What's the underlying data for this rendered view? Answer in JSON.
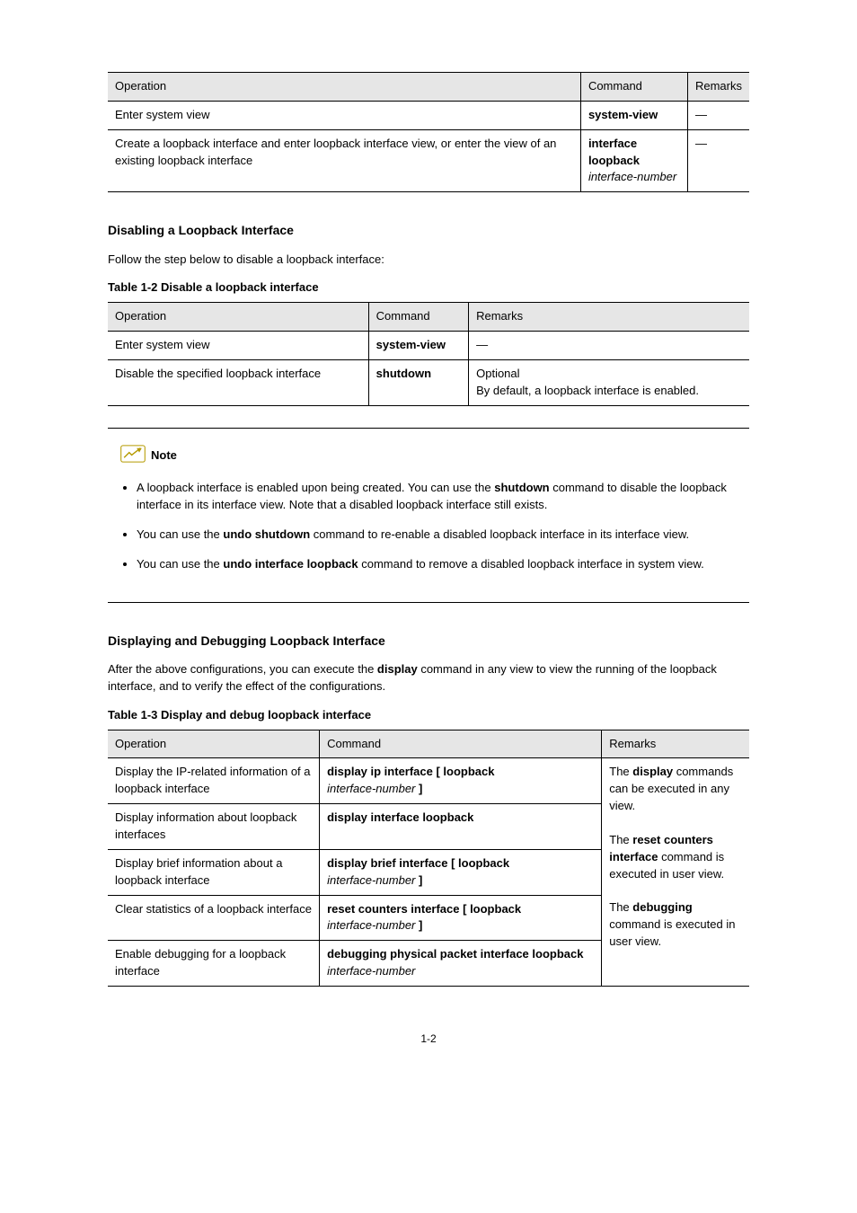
{
  "table_a_continued": {
    "headers": [
      "Operation",
      "Command",
      "Remarks"
    ],
    "rows": [
      {
        "op": "Enter system view",
        "cmd": "system-view",
        "rem": "—"
      },
      {
        "op_before_kw": "Create a loopback interface and enter loopback interface view, or enter the view of an existing ",
        "interface_type": "loopback",
        "op_after_kw": " interface",
        "cmd_kw": "interface",
        "cmd_arg": " loopback",
        "cmd_param": " interface-number",
        "rem": "—"
      }
    ]
  },
  "disable_section": {
    "title": "Disabling a Loopback Interface",
    "intro": "Follow the step below to disable a loopback interface:",
    "caption": "Table 1-2 Disable a loopback interface",
    "headers": [
      "Operation",
      "Command",
      "Remarks"
    ],
    "rows": [
      {
        "op": "Enter system view",
        "cmd": "system-view",
        "rem": "—"
      },
      {
        "op_pre": "Disable the specified ",
        "op_type": "loopback",
        "op_post": " interface",
        "cmd_kw": "shutdown",
        "rem_label": "Optional",
        "rem_desc": "By default, a loopback interface is enabled."
      }
    ]
  },
  "note": {
    "label": "Note",
    "items": [
      {
        "pre": "A loopback interface is enabled upon being created. You can use the ",
        "kw": "shutdown",
        "post": " command to disable the loopback interface in its interface view. Note that a disabled loopback interface still exists."
      },
      {
        "pre": "You can use the ",
        "kw": "undo shutdown",
        "post": " command to re-enable a disabled loopback interface in its interface view."
      },
      {
        "pre": "You can use the ",
        "kw": "undo interface loopback",
        "post": " command to remove a disabled loopback interface in system view."
      }
    ]
  },
  "display_section": {
    "title": "Displaying and Debugging Loopback Interface",
    "intro_pre": "After the above configurations, you can execute the ",
    "intro_kw": "display",
    "intro_post": " command in any view to view the running of the loopback interface, and to verify the effect of the configurations.",
    "caption": "Table 1-3 Display and debug loopback interface",
    "headers": [
      "Operation",
      "Command",
      "Remarks"
    ],
    "rows": [
      {
        "op_pre": "Display the IP-related information of a ",
        "op_type": "loopback",
        "op_post": " interface",
        "cmd_kw": "display ip interface",
        "cmd_arg": " [ loopback",
        "cmd_param": " interface-number",
        "cmd_close": " ]"
      },
      {
        "op_pre": "Display information about ",
        "op_type": "loopback",
        "op_post": " interfaces",
        "cmd_kw": "display interface loopback",
        "cmd_arg": "",
        "cmd_param": "",
        "cmd_close": ""
      },
      {
        "op_pre": "Display brief information about a ",
        "op_type": "loopback",
        "op_post": " interface",
        "cmd_kw": "display brief interface",
        "cmd_arg": " [ loopback",
        "cmd_param": " interface-number",
        "cmd_close": " ]"
      },
      {
        "op_pre": "Clear statistics of a ",
        "op_type": "loopback",
        "op_post": " interface",
        "cmd_kw": "reset counters interface",
        "cmd_arg": " [ loopback",
        "cmd_param": " interface-number",
        "cmd_close": " ]"
      },
      {
        "op_pre": "Enable debugging for a ",
        "op_type": "loopback",
        "op_post": " interface",
        "cmd_kw": "debugging physical packet interface loopback",
        "cmd_arg": "",
        "cmd_param": " interface-number",
        "cmd_close": ""
      }
    ],
    "remarks_pre": "The ",
    "remarks_kw1": "display",
    "remarks_mid": " commands can be executed in any view.\n\nThe ",
    "remarks_kw2": "reset counters interface",
    "remarks_post1": " command is executed in user view.\n\nThe ",
    "remarks_kw3": "debugging",
    "remarks_post2": " command is executed in user view."
  },
  "page_number": "1-2"
}
